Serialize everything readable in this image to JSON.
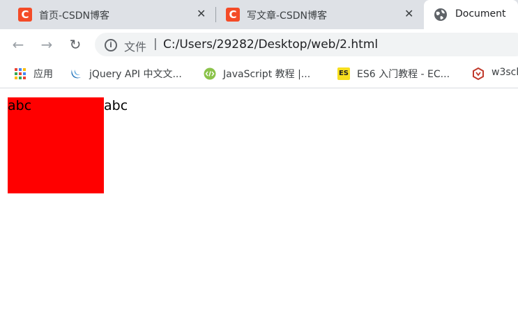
{
  "tabs": [
    {
      "favicon": "C",
      "title": "首页-CSDN博客",
      "close": "✕"
    },
    {
      "favicon": "C",
      "title": "写文章-CSDN博客",
      "close": "✕"
    },
    {
      "title": "Document"
    }
  ],
  "toolbar": {
    "back_glyph": "←",
    "forward_glyph": "→",
    "reload_glyph": "↻",
    "info_glyph": "i",
    "file_label": "文件",
    "separator": "|",
    "url": "C:/Users/29282/Desktop/web/2.html"
  },
  "bookmarks": [
    {
      "label": "应用"
    },
    {
      "label": "jQuery API 中文文..."
    },
    {
      "label": "JavaScript 教程 |..."
    },
    {
      "icon_text": "ES",
      "label": "ES6 入门教程 - EC..."
    },
    {
      "label": "w3scl"
    }
  ],
  "page": {
    "box_text": "abc",
    "after_text": "abc",
    "box_color": "#ff0000"
  }
}
